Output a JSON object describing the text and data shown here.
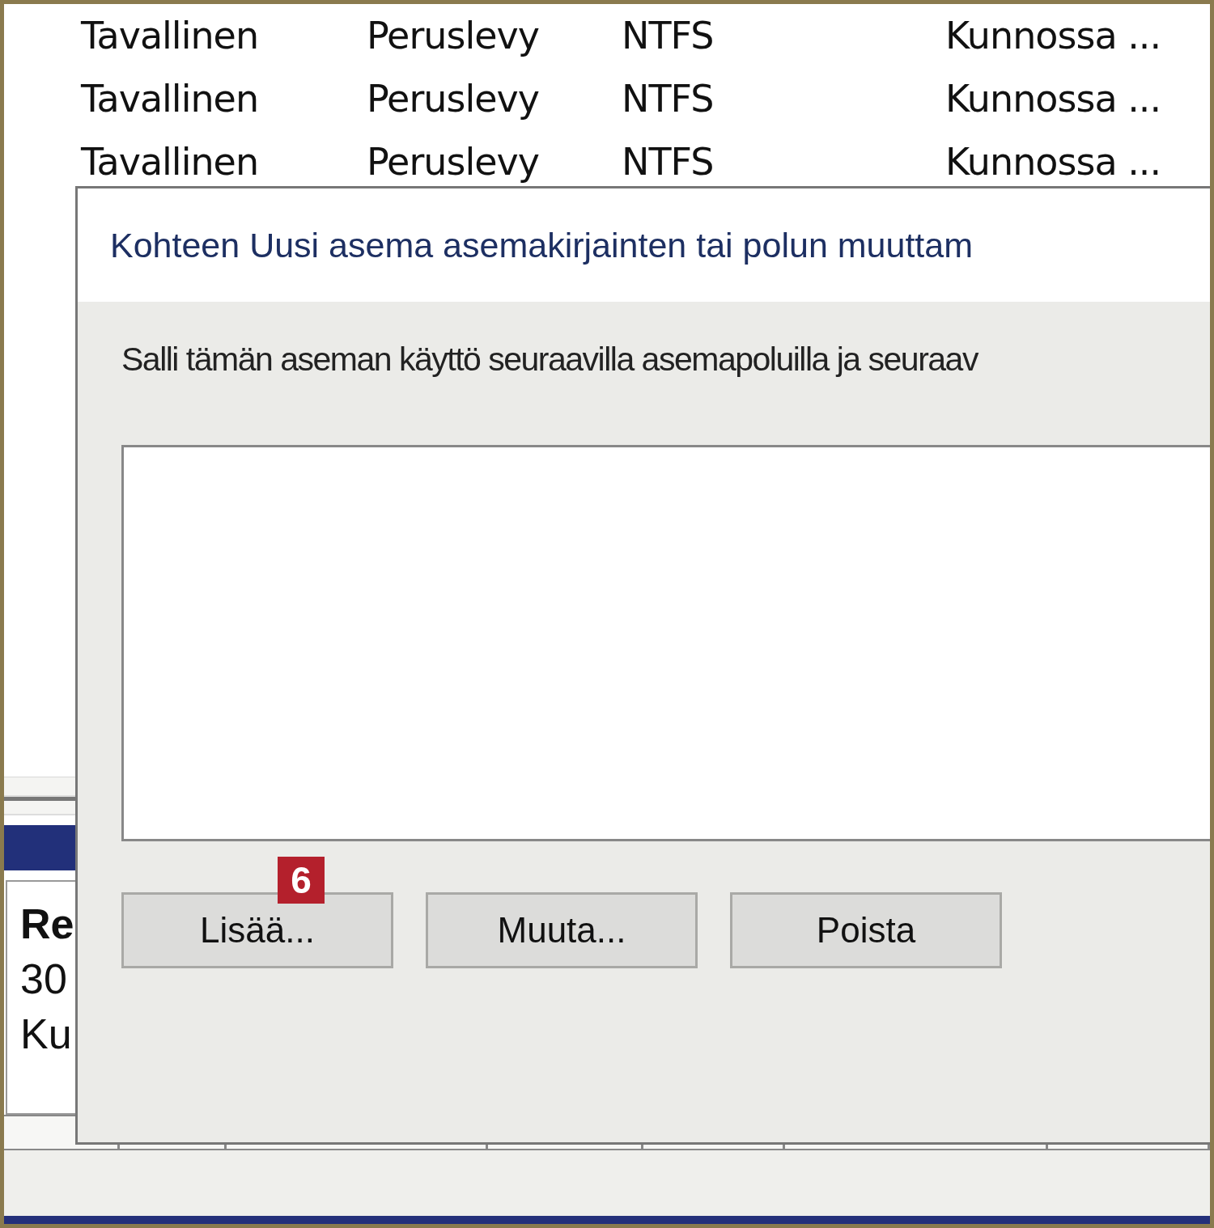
{
  "table": {
    "rows": [
      {
        "cells": [
          "Tavallinen",
          "Peruslevy",
          "NTFS",
          "Kunnossa ..."
        ]
      },
      {
        "cells": [
          "Tavallinen",
          "Peruslevy",
          "NTFS",
          "Kunnossa ..."
        ]
      },
      {
        "cells": [
          "Tavallinen",
          "Peruslevy",
          "NTFS",
          "Kunnossa ..."
        ]
      }
    ]
  },
  "disk_panel": {
    "title": "Re",
    "size": "30",
    "status": "Ku"
  },
  "dialog": {
    "title": "Kohteen Uusi asema asemakirjainten tai polun muuttam",
    "instruction": "Salli tämän aseman käyttö seuraavilla asemapoluilla ja seuraav",
    "buttons": [
      {
        "label": "Lisää..."
      },
      {
        "label": "Muuta..."
      },
      {
        "label": "Poista"
      }
    ],
    "badge": "6"
  }
}
